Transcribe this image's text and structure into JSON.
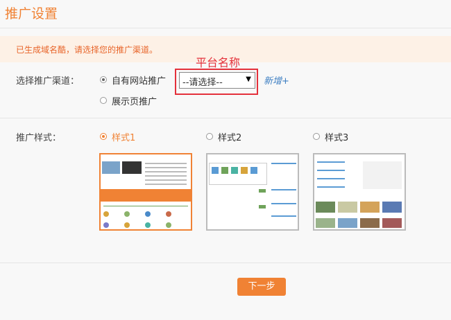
{
  "page_title": "推广设置",
  "notice": "已生成域名酷，请选择您的推广渠道。",
  "channel": {
    "label": "选择推广渠道：",
    "option_own_site": "自有网站推广",
    "option_showcase": "展示页推广",
    "select_value": "--请选择--",
    "annotation": "平台名称",
    "add_label": "新增+"
  },
  "style": {
    "label": "推广样式：",
    "options": [
      "样式1",
      "样式2",
      "样式3"
    ],
    "selected_index": 0
  },
  "next_button": "下一步",
  "colors": {
    "accent": "#f08234",
    "link": "#3c7ec2",
    "annotation": "#e4303a"
  }
}
